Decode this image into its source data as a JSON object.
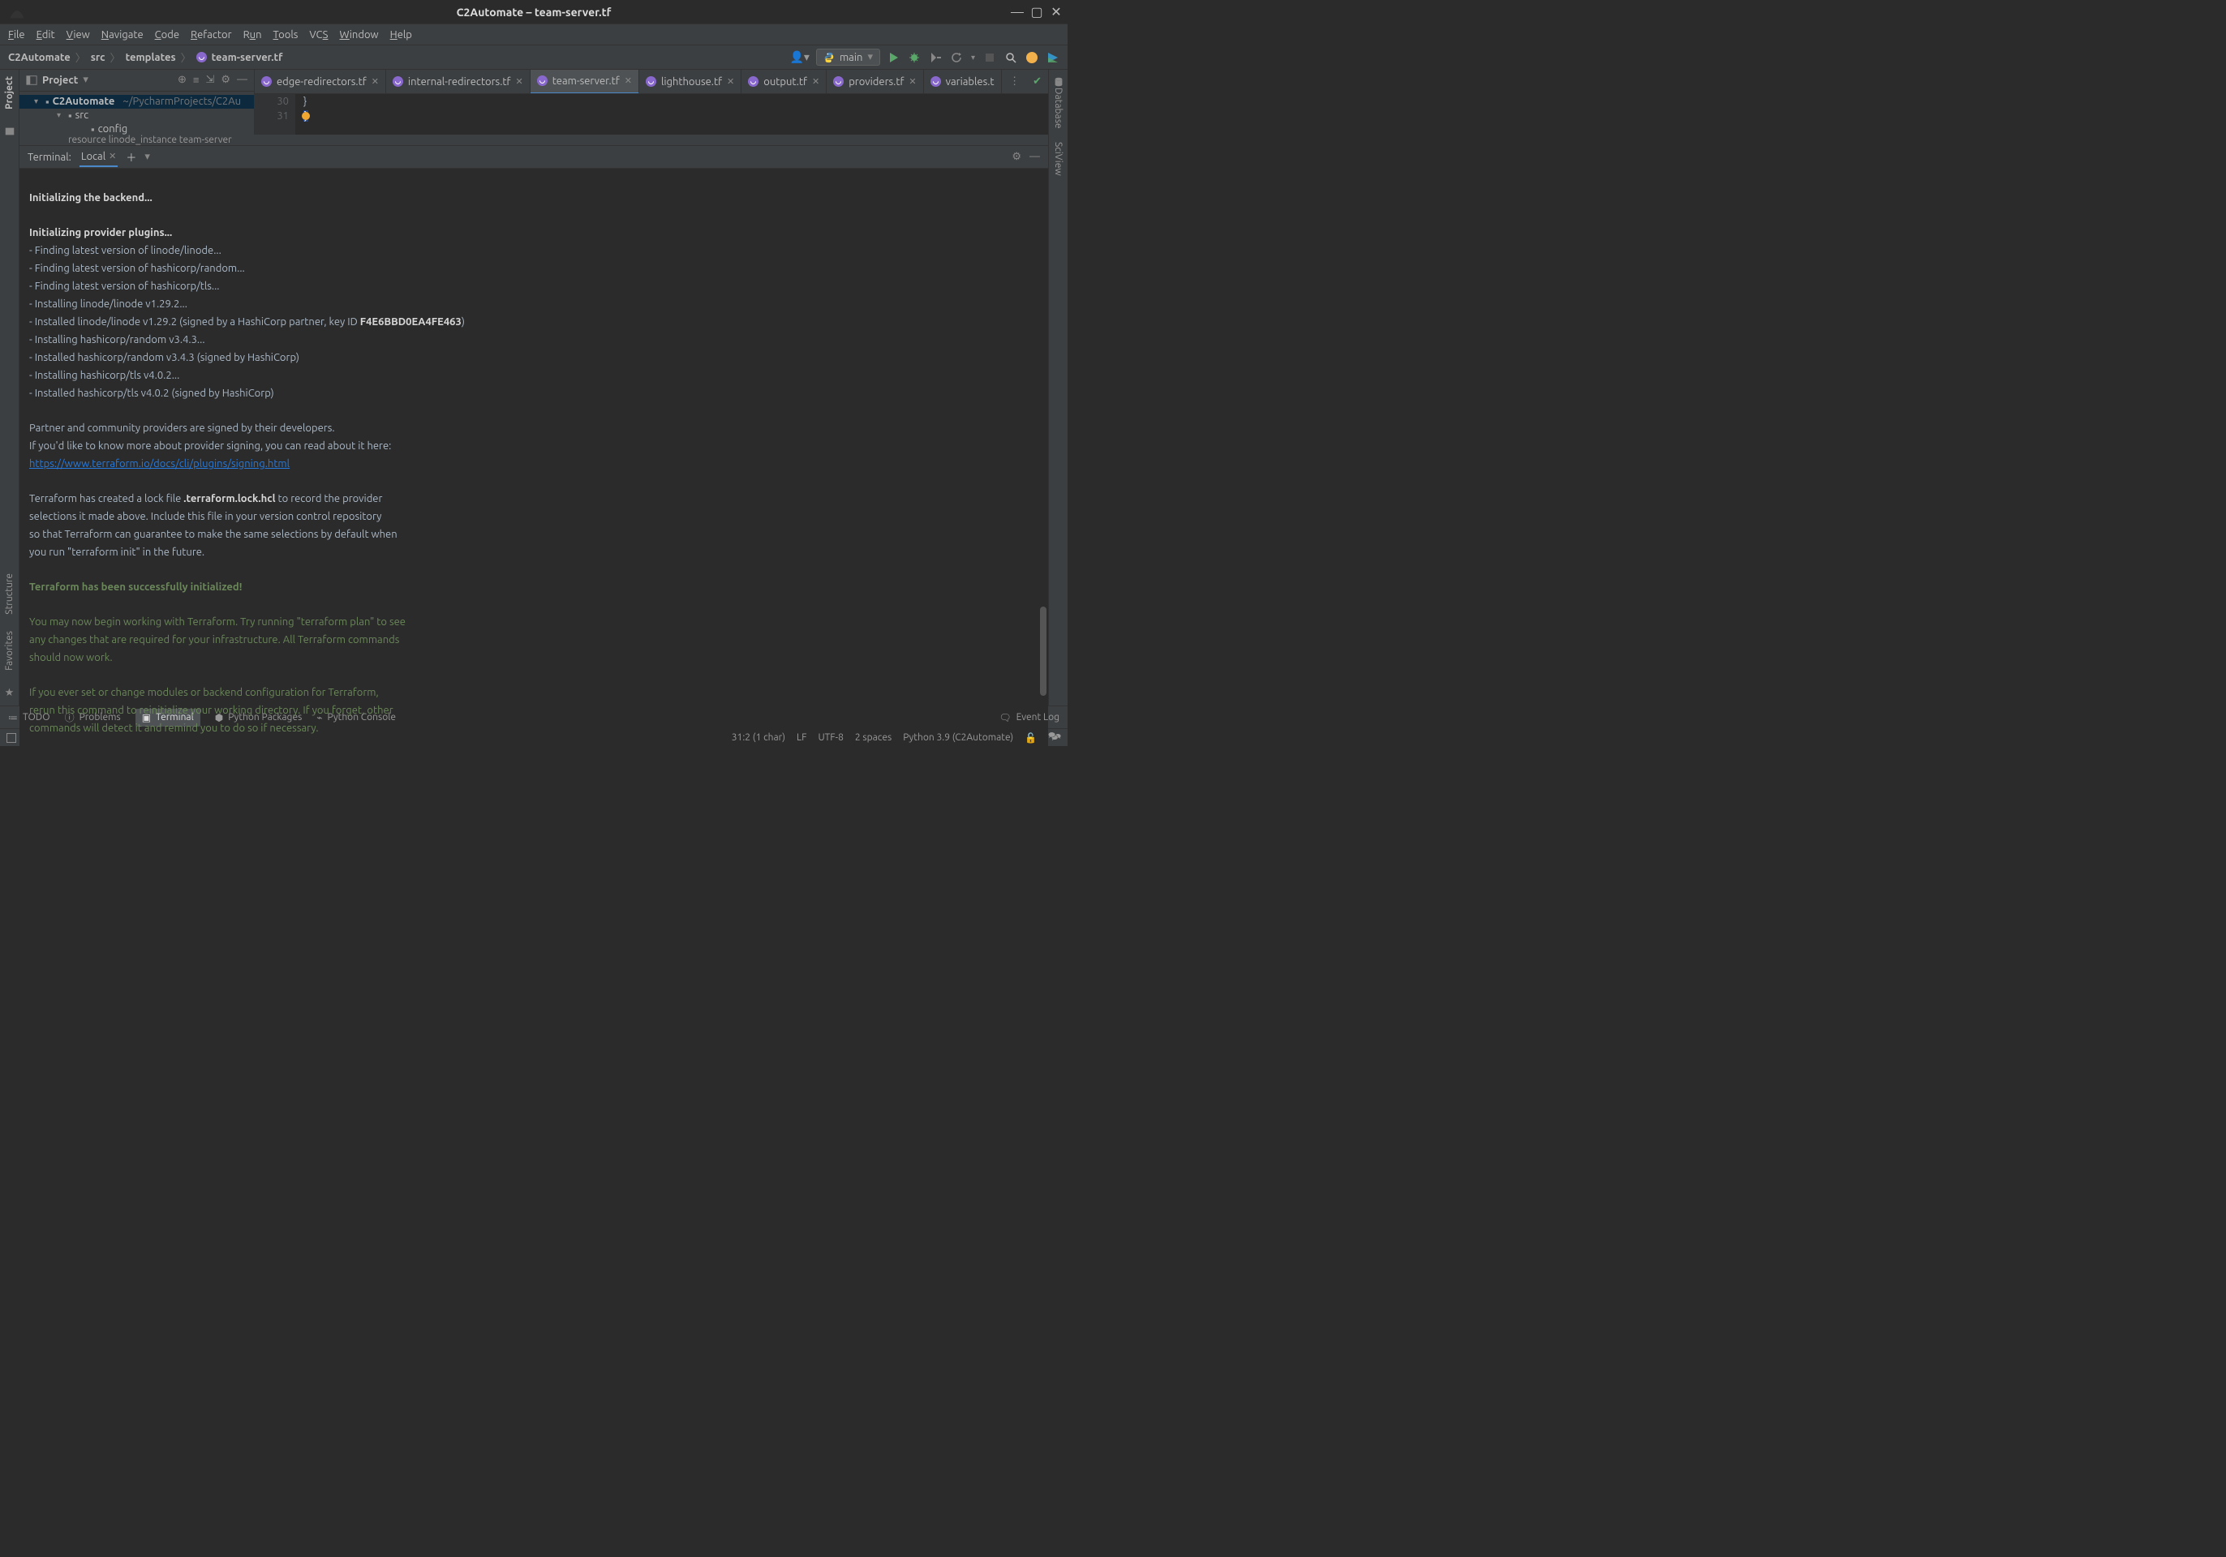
{
  "titlebar": {
    "title": "C2Automate – team-server.tf"
  },
  "menu": [
    "File",
    "Edit",
    "View",
    "Navigate",
    "Code",
    "Refactor",
    "Run",
    "Tools",
    "VCS",
    "Window",
    "Help"
  ],
  "breadcrumb": {
    "project": "C2Automate",
    "p1": "src",
    "p2": "templates",
    "file": "team-server.tf"
  },
  "runconfig": {
    "name": "main"
  },
  "project_panel": {
    "title": "Project",
    "root": "C2Automate",
    "root_path": "~/PycharmProjects/C2Au",
    "f1": "src",
    "f2": "config"
  },
  "tabs": [
    {
      "label": "edge-redirectors.tf"
    },
    {
      "label": "internal-redirectors.tf"
    },
    {
      "label": "team-server.tf"
    },
    {
      "label": "lighthouse.tf"
    },
    {
      "label": "output.tf"
    },
    {
      "label": "providers.tf"
    },
    {
      "label": "variables.t"
    }
  ],
  "editor": {
    "ln30": "30",
    "ln31": "31",
    "code30": "    }",
    "code31_brace": "}",
    "crumb": "resource  linode_instance  team-server"
  },
  "terminal": {
    "label": "Terminal:",
    "tab": "Local",
    "l1": "Initializing the backend...",
    "l2": "Initializing provider plugins...",
    "l3": "- Finding latest version of linode/linode...",
    "l4": "- Finding latest version of hashicorp/random...",
    "l5": "- Finding latest version of hashicorp/tls...",
    "l6": "- Installing linode/linode v1.29.2...",
    "l7a": "- Installed linode/linode v1.29.2 (signed by a HashiCorp partner, key ID ",
    "l7b": "F4E6BBD0EA4FE463",
    "l7c": ")",
    "l8": "- Installing hashicorp/random v3.4.3...",
    "l9": "- Installed hashicorp/random v3.4.3 (signed by HashiCorp)",
    "l10": "- Installing hashicorp/tls v4.0.2...",
    "l11": "- Installed hashicorp/tls v4.0.2 (signed by HashiCorp)",
    "l12": "Partner and community providers are signed by their developers.",
    "l13": "If you'd like to know more about provider signing, you can read about it here:",
    "l14": "https://www.terraform.io/docs/cli/plugins/signing.html",
    "l15a": "Terraform has created a lock file ",
    "l15b": ".terraform.lock.hcl",
    "l15c": " to record the provider",
    "l16": "selections it made above. Include this file in your version control repository",
    "l17": "so that Terraform can guarantee to make the same selections by default when",
    "l18": "you run \"terraform init\" in the future.",
    "l19": "Terraform has been successfully initialized!",
    "l20": "You may now begin working with Terraform. Try running \"terraform plan\" to see",
    "l21": "any changes that are required for your infrastructure. All Terraform commands",
    "l22": "should now work.",
    "l23": "If you ever set or change modules or backend configuration for Terraform,",
    "l24": "rerun this command to reinitialize your working directory. If you forget, other",
    "l25": "commands will detect it and remind you to do so if necessary."
  },
  "bottom_tools": {
    "todo": "TODO",
    "problems": "Problems",
    "terminal": "Terminal",
    "pypkg": "Python Packages",
    "pycon": "Python Console",
    "eventlog": "Event Log"
  },
  "status": {
    "pos": "31:2 (1 char)",
    "le": "LF",
    "enc": "UTF-8",
    "indent": "2 spaces",
    "interp": "Python 3.9 (C2Automate)"
  },
  "sidebars": {
    "project": "Project",
    "structure": "Structure",
    "favorites": "Favorites",
    "database": "Database",
    "sciview": "SciView"
  }
}
